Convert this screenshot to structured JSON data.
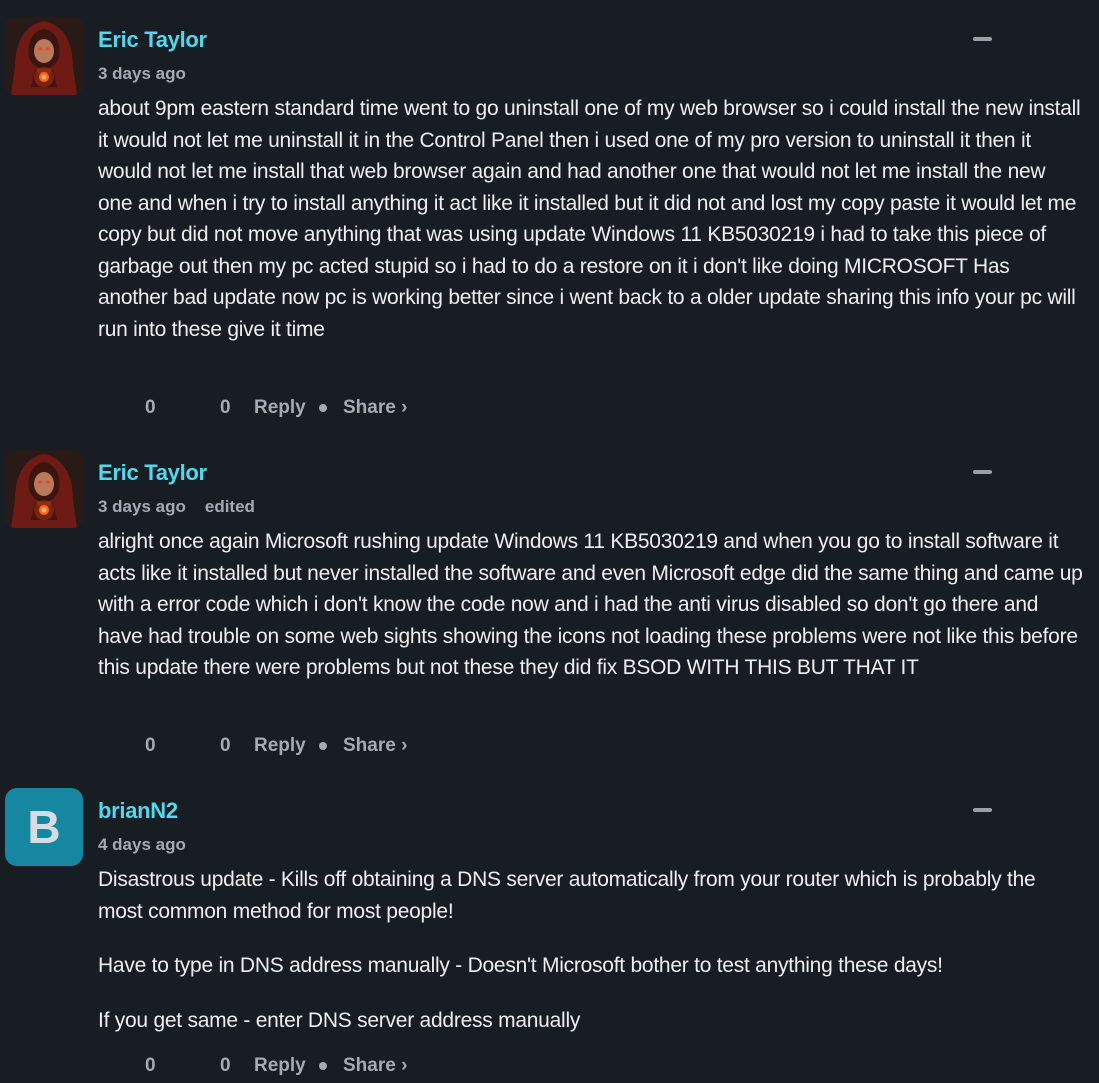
{
  "comments": [
    {
      "author": "Eric Taylor",
      "avatar_icon": "hooded-figure-avatar",
      "time": "3 days ago",
      "edited": "",
      "paragraphs": [
        "about 9pm eastern standard time went to go uninstall one of my web browser so i could install the new install it would not let me uninstall it in the Control Panel then i used one of my pro version to uninstall it then it would not let me install that web browser again and had another one that would not let me install the new one and when i try to install anything it act like it installed but it did not and lost my copy paste it would let me copy but did not move anything that was using update Windows 11 KB5030219 i had to take this piece of garbage out then my pc acted stupid so i had to do a restore on it i don't like doing MICROSOFT Has another bad update now pc is working better since i went back to a older update sharing this info your pc will run into these give it time"
      ],
      "upvotes": "0",
      "downvotes": "0",
      "reply_label": "Reply",
      "share_label": "Share ›"
    },
    {
      "author": "Eric Taylor",
      "avatar_icon": "hooded-figure-avatar",
      "time": "3 days ago",
      "edited": "edited",
      "paragraphs": [
        "alright once again Microsoft rushing update Windows 11 KB5030219 and when you go to install software it acts like it installed but never installed the software and even Microsoft edge did the same thing and came up with a error code which i don't know the code now and i had the anti virus disabled so don't go there and have had trouble on some web sights showing the icons not loading these problems were not like this before this update there were problems but not these they did fix BSOD WITH THIS BUT THAT IT"
      ],
      "upvotes": "0",
      "downvotes": "0",
      "reply_label": "Reply",
      "share_label": "Share ›"
    },
    {
      "author": "brianN2",
      "avatar_letter": "B",
      "avatar_color": "#1687a1",
      "time": "4 days ago",
      "edited": "",
      "paragraphs": [
        "Disastrous update - Kills off obtaining a DNS server automatically from your router which is probably the most common method for most people!",
        "Have to type in DNS address manually - Doesn't Microsoft bother to test anything these days!",
        "If you get same - enter DNS server address manually"
      ],
      "upvotes": "0",
      "downvotes": "0",
      "reply_label": "Reply",
      "share_label": "Share ›"
    }
  ],
  "colors": {
    "background": "#181d24",
    "author": "#4fd9ef",
    "meta": "#a6abb2",
    "body_text": "#eceef1"
  }
}
